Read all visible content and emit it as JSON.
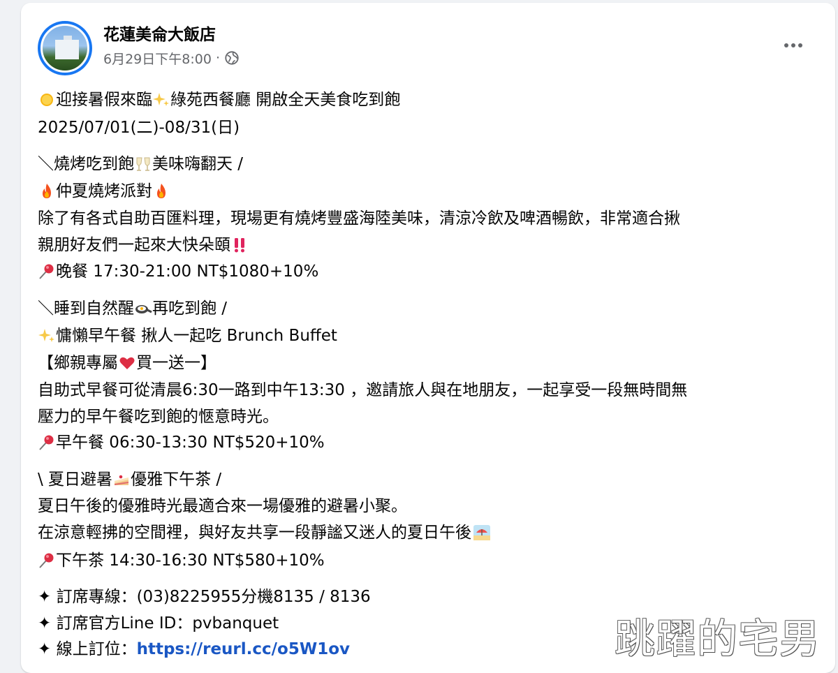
{
  "post": {
    "page_name": "花蓮美侖大飯店",
    "timestamp": "6月29日下午8:00",
    "separator": "·",
    "privacy_icon": "globe-icon",
    "more_icon": "more-options-icon"
  },
  "content": {
    "line1_a": "迎接暑假來臨",
    "line1_b": "綠苑西餐廳 開啟全天美食吃到飽",
    "line2": "2025/07/01(二)-08/31(日)",
    "bbq_head_a": "＼燒烤吃到飽",
    "bbq_head_b": "美味嗨翻天 /",
    "bbq_title": "仲夏燒烤派對",
    "bbq_desc1": "除了有各式自助百匯料理，現場更有燒烤豐盛海陸美味，清涼冷飲及啤酒暢飲，非常適合揪",
    "bbq_desc2": "親朋好友們一起來大快朵頤",
    "bbq_price": "晚餐 17:30-21:00  NT$1080+10%",
    "brunch_head_a": "＼睡到自然醒",
    "brunch_head_b": "再吃到飽 /",
    "brunch_title": "慵懶早午餐 揪人一起吃 Brunch Buffet",
    "brunch_promo_a": "【鄉親專屬",
    "brunch_promo_b": "買一送一】",
    "brunch_desc1": "自助式早餐可從清晨6:30一路到中午13:30 ，邀請旅人與在地朋友，一起享受一段無時間無",
    "brunch_desc2": "壓力的早午餐吃到飽的愜意時光。",
    "brunch_price": "早午餐 06:30-13:30  NT$520+10%",
    "tea_head_a": "\\ 夏日避暑",
    "tea_head_b": "優雅下午茶 /",
    "tea_desc1": "夏日午後的優雅時光最適合來一場優雅的避暑小聚。",
    "tea_desc2": "在涼意輕拂的空間裡，與好友共享一段靜謐又迷人的夏日午後",
    "tea_price": "下午茶 14:30-16:30  NT$580+10%",
    "contact_phone": "✦ 訂席專線：(03)8225955分機8135 / 8136",
    "contact_line": "✦ 訂席官方Line ID：pvbanquet",
    "contact_online_label": "✦ 線上訂位：",
    "contact_online_url": "https://reurl.cc/o5W1ov"
  },
  "watermark": "跳躍的宅男",
  "colors": {
    "link": "#1a57c4",
    "meta": "#65676b",
    "avatar_ring": "#1877f2"
  }
}
